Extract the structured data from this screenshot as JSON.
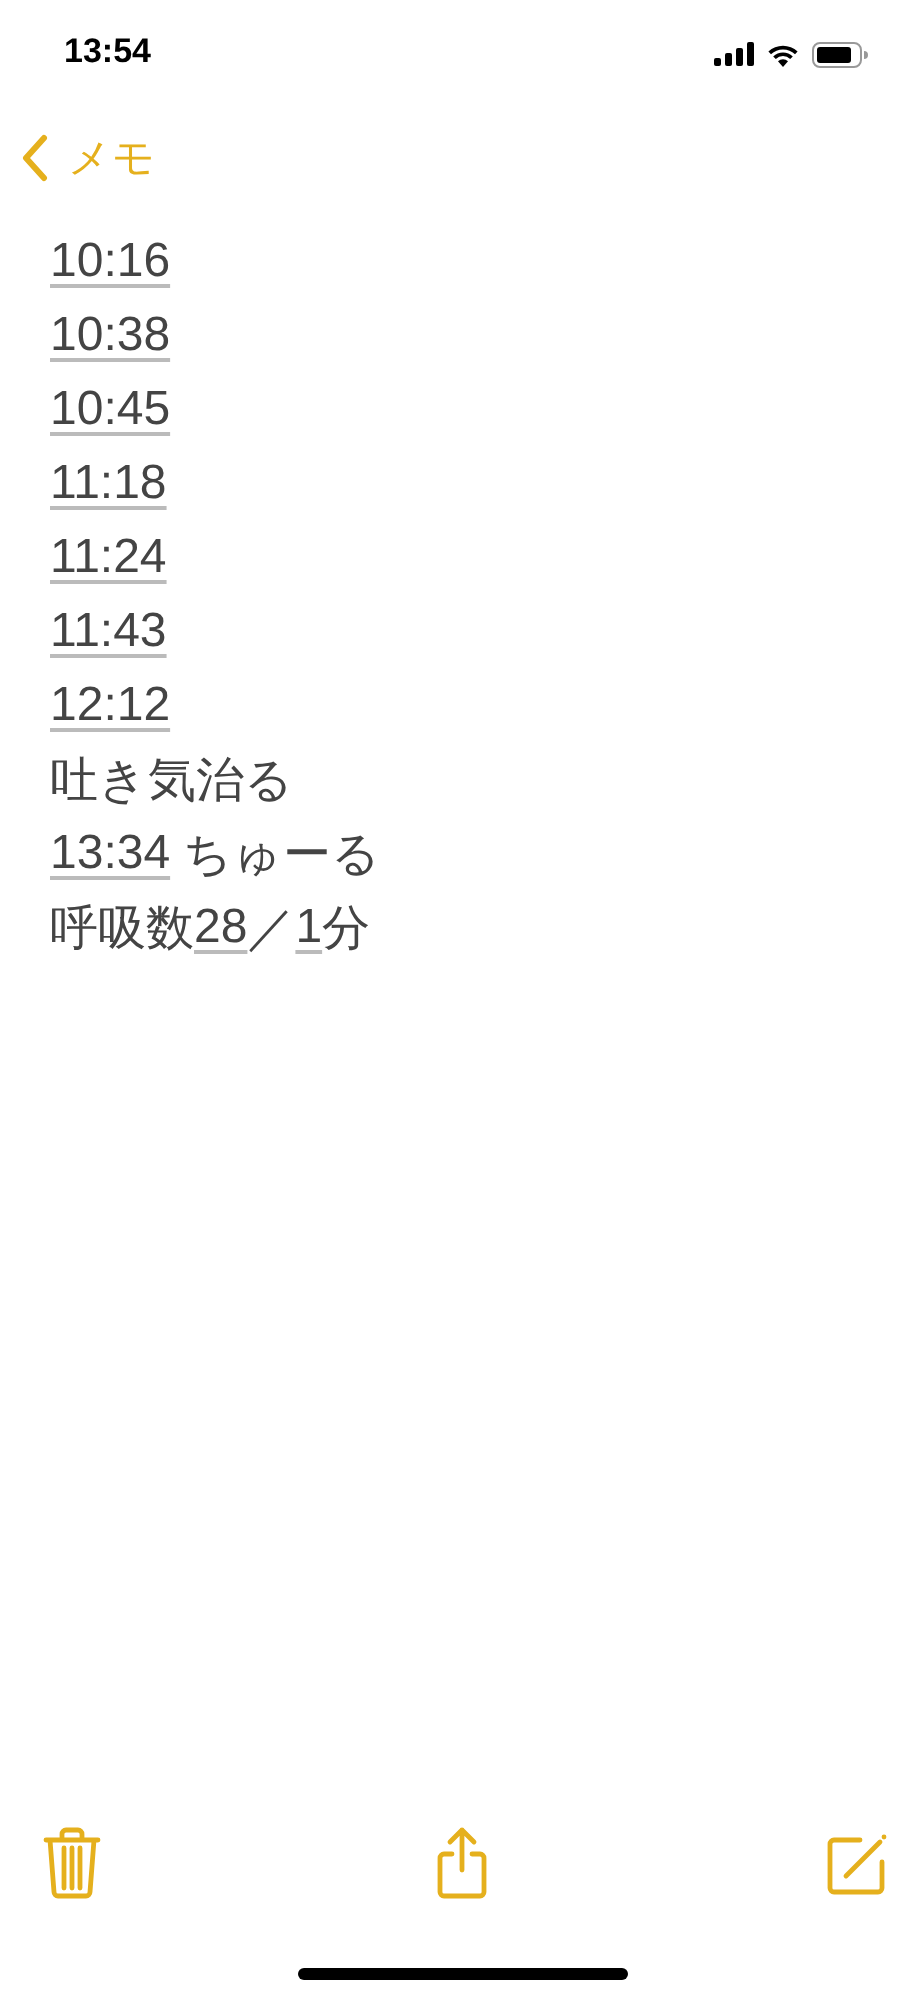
{
  "status_bar": {
    "time": "13:54"
  },
  "nav": {
    "back_label": "メモ"
  },
  "note": {
    "lines": [
      {
        "segments": [
          {
            "text": "10:16",
            "link": true
          }
        ]
      },
      {
        "segments": [
          {
            "text": "10:38",
            "link": true
          }
        ]
      },
      {
        "segments": [
          {
            "text": "10:45",
            "link": true
          }
        ]
      },
      {
        "segments": [
          {
            "text": "11:18",
            "link": true
          }
        ]
      },
      {
        "segments": [
          {
            "text": "11:24",
            "link": true
          }
        ]
      },
      {
        "segments": [
          {
            "text": "11:43",
            "link": true
          }
        ]
      },
      {
        "segments": [
          {
            "text": "12:12",
            "link": true
          }
        ]
      },
      {
        "segments": [
          {
            "text": "吐き気治る",
            "link": false
          }
        ]
      },
      {
        "segments": [
          {
            "text": "13:34",
            "link": true
          },
          {
            "text": " ちゅーる",
            "link": false
          }
        ]
      },
      {
        "segments": [
          {
            "text": "呼吸数",
            "link": false
          },
          {
            "text": "28",
            "link": true
          },
          {
            "text": "／",
            "link": false
          },
          {
            "text": "1",
            "link": true
          },
          {
            "text": "分",
            "link": false
          }
        ]
      }
    ]
  },
  "toolbar": {
    "items": [
      {
        "kind": "trash"
      },
      {
        "kind": "share"
      },
      {
        "kind": "compose"
      }
    ]
  }
}
